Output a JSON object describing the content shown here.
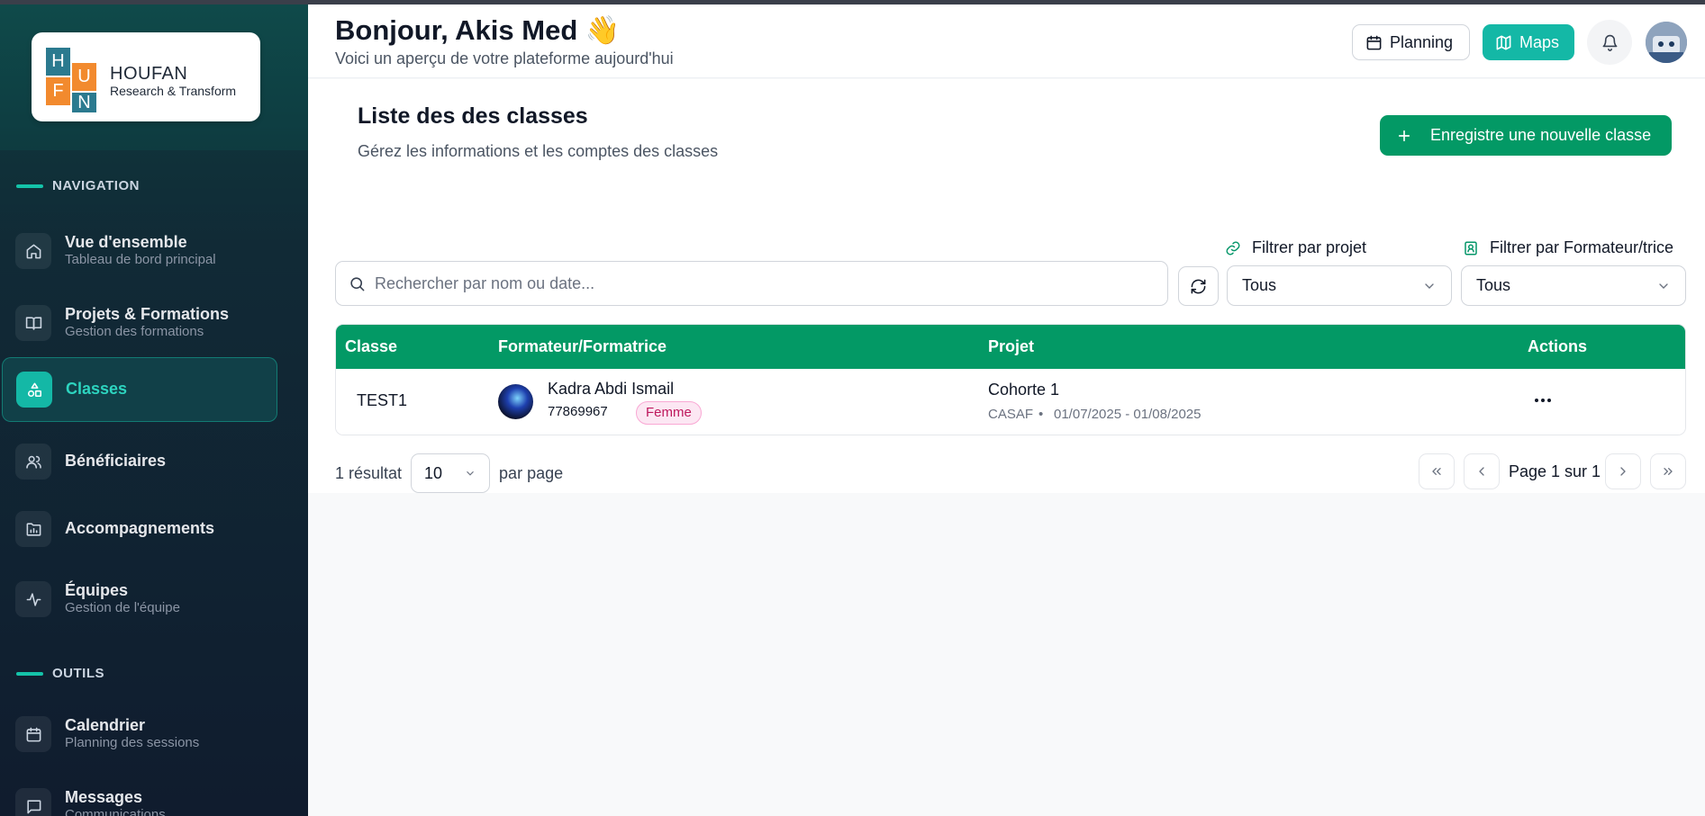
{
  "brand": {
    "letters": [
      "H",
      "U",
      "F",
      "N"
    ],
    "name": "HOUFAN",
    "tagline": "Research & Transform",
    "colors": {
      "blue": "#2b7a8f",
      "orange": "#f28a2e",
      "teal": "#14b8a6",
      "green": "#039965"
    }
  },
  "sidebar": {
    "sections": [
      {
        "label": "NAVIGATION",
        "items": [
          {
            "icon": "home-icon",
            "title": "Vue d'ensemble",
            "subtitle": "Tableau de bord principal",
            "active": false
          },
          {
            "icon": "book-icon",
            "title": "Projets & Formations",
            "subtitle": "Gestion des formations",
            "active": false
          },
          {
            "icon": "shapes-icon",
            "title": "Classes",
            "subtitle": "",
            "active": true
          },
          {
            "icon": "users-icon",
            "title": "Bénéficiaires",
            "subtitle": "",
            "active": false
          },
          {
            "icon": "chart-folder-icon",
            "title": "Accompagnements",
            "subtitle": "",
            "active": false
          },
          {
            "icon": "activity-icon",
            "title": "Équipes",
            "subtitle": "Gestion de l'équipe",
            "active": false
          }
        ]
      },
      {
        "label": "OUTILS",
        "items": [
          {
            "icon": "calendar-icon",
            "title": "Calendrier",
            "subtitle": "Planning des sessions",
            "active": false
          },
          {
            "icon": "message-icon",
            "title": "Messages",
            "subtitle": "Communications",
            "active": false
          }
        ]
      }
    ]
  },
  "header": {
    "greeting": "Bonjour, Akis Med 👋",
    "subtitle": "Voici un aperçu de votre plateforme aujourd'hui",
    "planning_label": "Planning",
    "maps_label": "Maps"
  },
  "page": {
    "title": "Liste des des classes",
    "subtitle": "Gérez les informations et les comptes des classes",
    "add_button": "Enregistre une nouvelle classe"
  },
  "filters": {
    "search_placeholder": "Rechercher par nom ou date...",
    "project_label": "Filtrer par projet",
    "project_value": "Tous",
    "trainer_label": "Filtrer par Formateur/trice",
    "trainer_value": "Tous"
  },
  "table": {
    "columns": [
      "Classe",
      "Formateur/Formatrice",
      "Projet",
      "Actions"
    ],
    "rows": [
      {
        "classe": "TEST1",
        "trainer_name": "Kadra Abdi Ismail",
        "trainer_phone": "77869967",
        "trainer_gender": "Femme",
        "project_name": "Cohorte 1",
        "project_org": "CASAF",
        "project_dates": "01/07/2025 - 01/08/2025"
      }
    ]
  },
  "pagination": {
    "results": "1 résultat",
    "per_page_value": "10",
    "per_page_label": "par page",
    "page_text": "Page 1 sur 1"
  }
}
